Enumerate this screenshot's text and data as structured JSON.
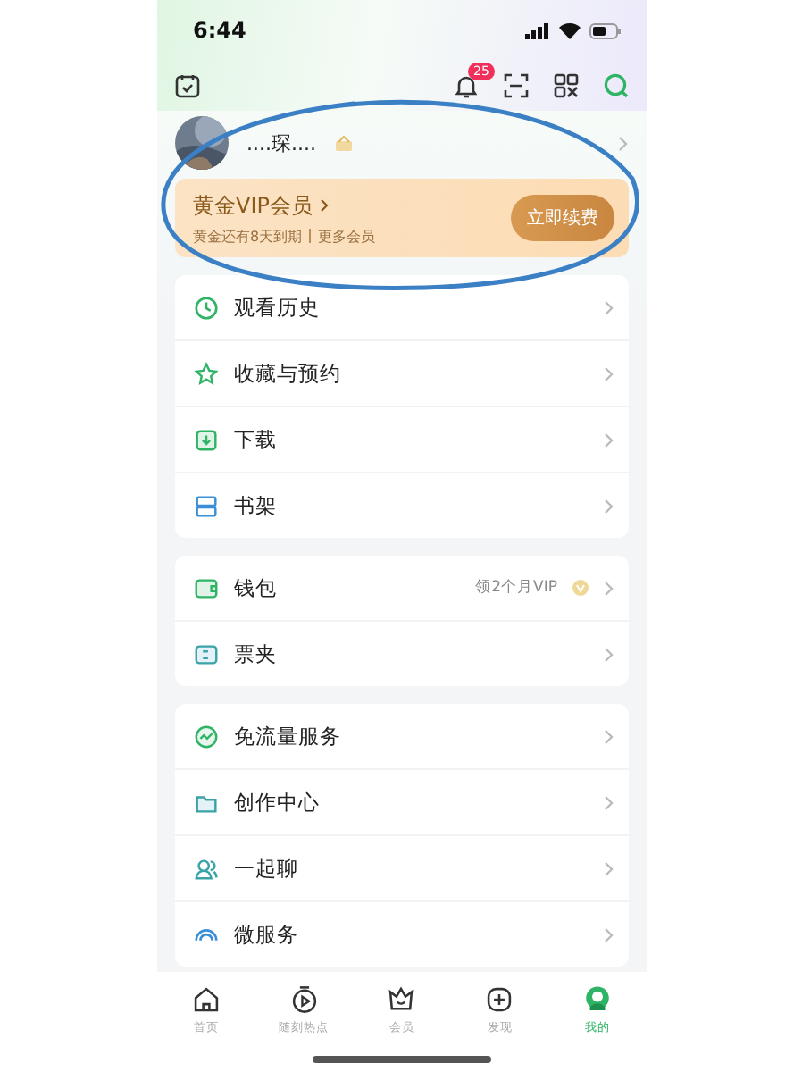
{
  "status_bar": {
    "time": "6:44"
  },
  "header": {
    "notification_count": "25"
  },
  "profile": {
    "name": "....琛...."
  },
  "vip_card": {
    "title": "黄金VIP会员",
    "expiry": "黄金还有8天到期",
    "more_link": "更多会员",
    "renew_button": "立即续费"
  },
  "menu_groups": [
    [
      {
        "label": "观看历史"
      },
      {
        "label": "收藏与预约"
      },
      {
        "label": "下载"
      },
      {
        "label": "书架"
      }
    ],
    [
      {
        "label": "钱包",
        "note": "领2个月VIP"
      },
      {
        "label": "票夹"
      }
    ],
    [
      {
        "label": "免流量服务"
      },
      {
        "label": "创作中心"
      },
      {
        "label": "一起聊"
      },
      {
        "label": "微服务"
      }
    ]
  ],
  "tab_bar": [
    {
      "label": "首页",
      "selected": false
    },
    {
      "label": "随刻热点",
      "selected": false
    },
    {
      "label": "会员",
      "selected": false
    },
    {
      "label": "发现",
      "selected": false
    },
    {
      "label": "我的",
      "selected": true
    }
  ]
}
